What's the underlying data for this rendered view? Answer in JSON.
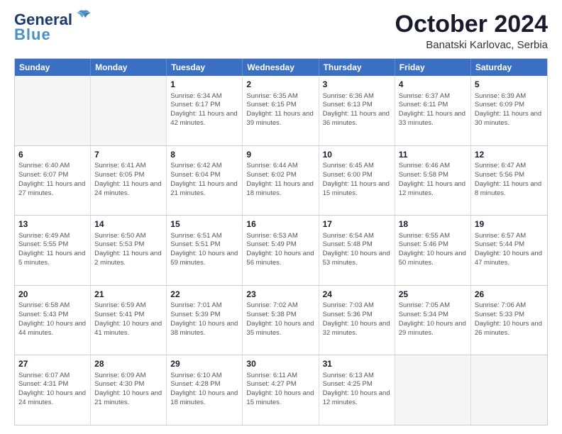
{
  "header": {
    "logo_line1": "General",
    "logo_line2": "Blue",
    "month": "October 2024",
    "location": "Banatski Karlovac, Serbia"
  },
  "days_of_week": [
    "Sunday",
    "Monday",
    "Tuesday",
    "Wednesday",
    "Thursday",
    "Friday",
    "Saturday"
  ],
  "weeks": [
    [
      {
        "day": "",
        "sunrise": "",
        "sunset": "",
        "daylight": "",
        "empty": true
      },
      {
        "day": "",
        "sunrise": "",
        "sunset": "",
        "daylight": "",
        "empty": true
      },
      {
        "day": "1",
        "sunrise": "Sunrise: 6:34 AM",
        "sunset": "Sunset: 6:17 PM",
        "daylight": "Daylight: 11 hours and 42 minutes."
      },
      {
        "day": "2",
        "sunrise": "Sunrise: 6:35 AM",
        "sunset": "Sunset: 6:15 PM",
        "daylight": "Daylight: 11 hours and 39 minutes."
      },
      {
        "day": "3",
        "sunrise": "Sunrise: 6:36 AM",
        "sunset": "Sunset: 6:13 PM",
        "daylight": "Daylight: 11 hours and 36 minutes."
      },
      {
        "day": "4",
        "sunrise": "Sunrise: 6:37 AM",
        "sunset": "Sunset: 6:11 PM",
        "daylight": "Daylight: 11 hours and 33 minutes."
      },
      {
        "day": "5",
        "sunrise": "Sunrise: 6:39 AM",
        "sunset": "Sunset: 6:09 PM",
        "daylight": "Daylight: 11 hours and 30 minutes."
      }
    ],
    [
      {
        "day": "6",
        "sunrise": "Sunrise: 6:40 AM",
        "sunset": "Sunset: 6:07 PM",
        "daylight": "Daylight: 11 hours and 27 minutes."
      },
      {
        "day": "7",
        "sunrise": "Sunrise: 6:41 AM",
        "sunset": "Sunset: 6:05 PM",
        "daylight": "Daylight: 11 hours and 24 minutes."
      },
      {
        "day": "8",
        "sunrise": "Sunrise: 6:42 AM",
        "sunset": "Sunset: 6:04 PM",
        "daylight": "Daylight: 11 hours and 21 minutes."
      },
      {
        "day": "9",
        "sunrise": "Sunrise: 6:44 AM",
        "sunset": "Sunset: 6:02 PM",
        "daylight": "Daylight: 11 hours and 18 minutes."
      },
      {
        "day": "10",
        "sunrise": "Sunrise: 6:45 AM",
        "sunset": "Sunset: 6:00 PM",
        "daylight": "Daylight: 11 hours and 15 minutes."
      },
      {
        "day": "11",
        "sunrise": "Sunrise: 6:46 AM",
        "sunset": "Sunset: 5:58 PM",
        "daylight": "Daylight: 11 hours and 12 minutes."
      },
      {
        "day": "12",
        "sunrise": "Sunrise: 6:47 AM",
        "sunset": "Sunset: 5:56 PM",
        "daylight": "Daylight: 11 hours and 8 minutes."
      }
    ],
    [
      {
        "day": "13",
        "sunrise": "Sunrise: 6:49 AM",
        "sunset": "Sunset: 5:55 PM",
        "daylight": "Daylight: 11 hours and 5 minutes."
      },
      {
        "day": "14",
        "sunrise": "Sunrise: 6:50 AM",
        "sunset": "Sunset: 5:53 PM",
        "daylight": "Daylight: 11 hours and 2 minutes."
      },
      {
        "day": "15",
        "sunrise": "Sunrise: 6:51 AM",
        "sunset": "Sunset: 5:51 PM",
        "daylight": "Daylight: 10 hours and 59 minutes."
      },
      {
        "day": "16",
        "sunrise": "Sunrise: 6:53 AM",
        "sunset": "Sunset: 5:49 PM",
        "daylight": "Daylight: 10 hours and 56 minutes."
      },
      {
        "day": "17",
        "sunrise": "Sunrise: 6:54 AM",
        "sunset": "Sunset: 5:48 PM",
        "daylight": "Daylight: 10 hours and 53 minutes."
      },
      {
        "day": "18",
        "sunrise": "Sunrise: 6:55 AM",
        "sunset": "Sunset: 5:46 PM",
        "daylight": "Daylight: 10 hours and 50 minutes."
      },
      {
        "day": "19",
        "sunrise": "Sunrise: 6:57 AM",
        "sunset": "Sunset: 5:44 PM",
        "daylight": "Daylight: 10 hours and 47 minutes."
      }
    ],
    [
      {
        "day": "20",
        "sunrise": "Sunrise: 6:58 AM",
        "sunset": "Sunset: 5:43 PM",
        "daylight": "Daylight: 10 hours and 44 minutes."
      },
      {
        "day": "21",
        "sunrise": "Sunrise: 6:59 AM",
        "sunset": "Sunset: 5:41 PM",
        "daylight": "Daylight: 10 hours and 41 minutes."
      },
      {
        "day": "22",
        "sunrise": "Sunrise: 7:01 AM",
        "sunset": "Sunset: 5:39 PM",
        "daylight": "Daylight: 10 hours and 38 minutes."
      },
      {
        "day": "23",
        "sunrise": "Sunrise: 7:02 AM",
        "sunset": "Sunset: 5:38 PM",
        "daylight": "Daylight: 10 hours and 35 minutes."
      },
      {
        "day": "24",
        "sunrise": "Sunrise: 7:03 AM",
        "sunset": "Sunset: 5:36 PM",
        "daylight": "Daylight: 10 hours and 32 minutes."
      },
      {
        "day": "25",
        "sunrise": "Sunrise: 7:05 AM",
        "sunset": "Sunset: 5:34 PM",
        "daylight": "Daylight: 10 hours and 29 minutes."
      },
      {
        "day": "26",
        "sunrise": "Sunrise: 7:06 AM",
        "sunset": "Sunset: 5:33 PM",
        "daylight": "Daylight: 10 hours and 26 minutes."
      }
    ],
    [
      {
        "day": "27",
        "sunrise": "Sunrise: 6:07 AM",
        "sunset": "Sunset: 4:31 PM",
        "daylight": "Daylight: 10 hours and 24 minutes."
      },
      {
        "day": "28",
        "sunrise": "Sunrise: 6:09 AM",
        "sunset": "Sunset: 4:30 PM",
        "daylight": "Daylight: 10 hours and 21 minutes."
      },
      {
        "day": "29",
        "sunrise": "Sunrise: 6:10 AM",
        "sunset": "Sunset: 4:28 PM",
        "daylight": "Daylight: 10 hours and 18 minutes."
      },
      {
        "day": "30",
        "sunrise": "Sunrise: 6:11 AM",
        "sunset": "Sunset: 4:27 PM",
        "daylight": "Daylight: 10 hours and 15 minutes."
      },
      {
        "day": "31",
        "sunrise": "Sunrise: 6:13 AM",
        "sunset": "Sunset: 4:25 PM",
        "daylight": "Daylight: 10 hours and 12 minutes."
      },
      {
        "day": "",
        "sunrise": "",
        "sunset": "",
        "daylight": "",
        "empty": true
      },
      {
        "day": "",
        "sunrise": "",
        "sunset": "",
        "daylight": "",
        "empty": true
      }
    ]
  ]
}
